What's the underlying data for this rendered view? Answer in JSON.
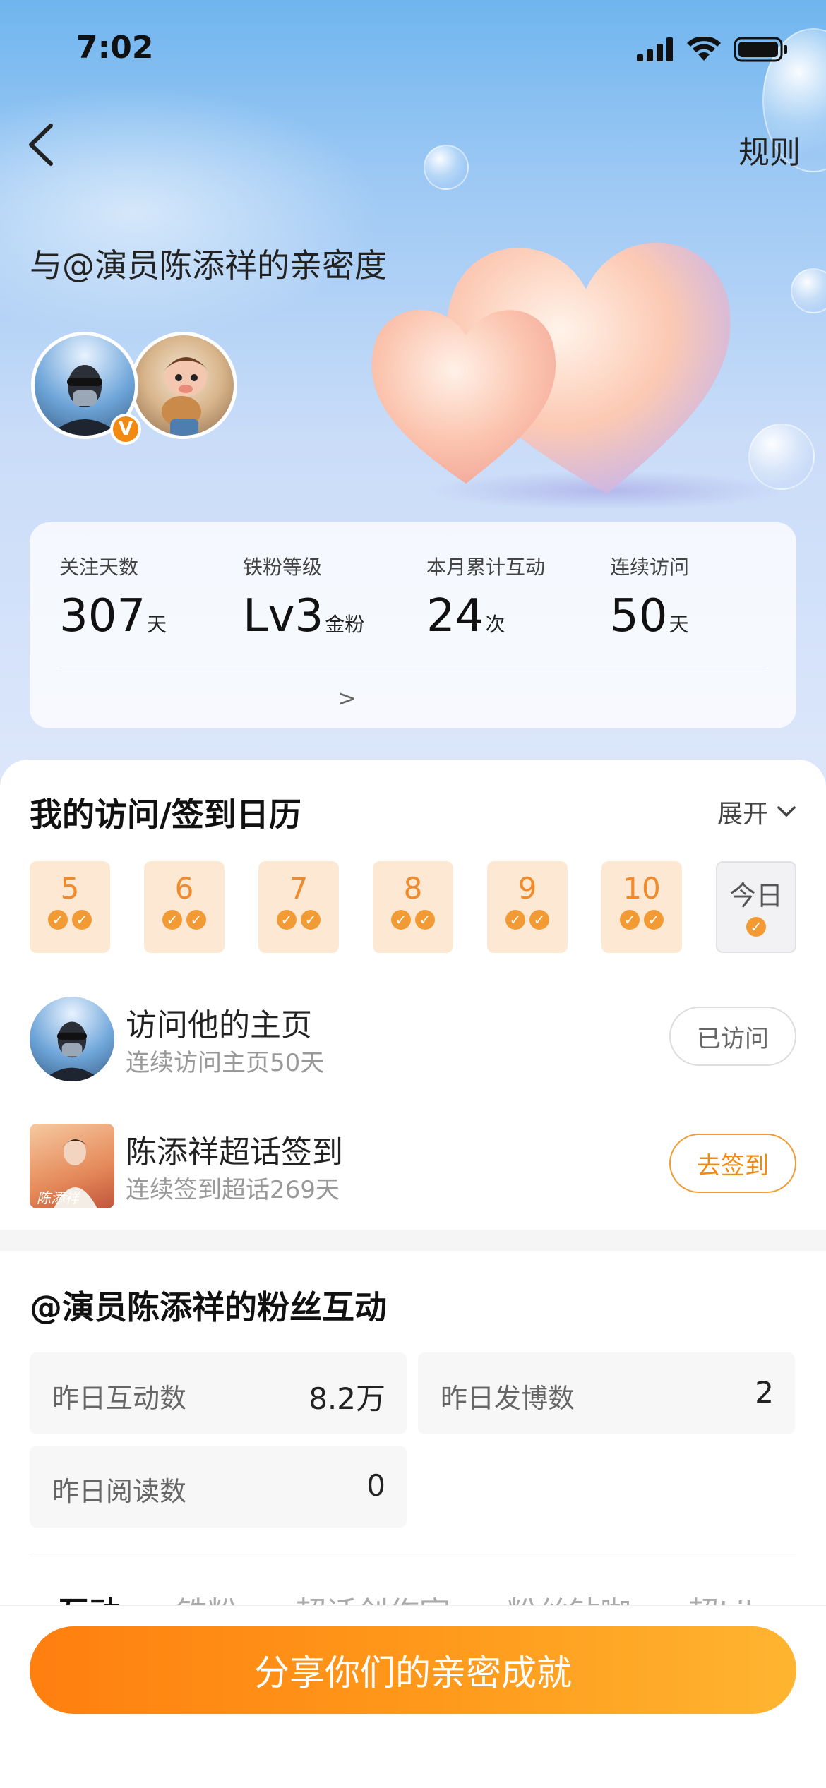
{
  "status_bar": {
    "time": "7:02"
  },
  "header": {
    "rules_label": "规则"
  },
  "hero": {
    "title": "与@演员陈添祥的亲密度",
    "verified_badge": "V"
  },
  "stats": [
    {
      "label": "关注天数",
      "value": "307",
      "unit": "天"
    },
    {
      "label": "铁粉等级",
      "value": "Lv3",
      "unit": "金粉"
    },
    {
      "label": "本月累计互动",
      "value": "24",
      "unit": "次"
    },
    {
      "label": "连续访问",
      "value": "50",
      "unit": "天"
    }
  ],
  "stats_more": ">",
  "calendar": {
    "title": "我的访问/签到日历",
    "expand_label": "展开",
    "days": [
      {
        "label": "5",
        "checks": 2
      },
      {
        "label": "6",
        "checks": 2
      },
      {
        "label": "7",
        "checks": 2
      },
      {
        "label": "8",
        "checks": 2
      },
      {
        "label": "9",
        "checks": 2
      },
      {
        "label": "10",
        "checks": 2
      },
      {
        "label": "今日",
        "checks": 1
      }
    ]
  },
  "tasks": [
    {
      "title": "访问他的主页",
      "subtitle": "连续访问主页50天",
      "button": "已访问"
    },
    {
      "title": "陈添祥超话签到",
      "subtitle": "连续签到超话269天",
      "button": "去签到",
      "thumb_text": "陈添祥"
    }
  ],
  "fan_interaction": {
    "title": "@演员陈添祥的粉丝互动",
    "metrics": [
      {
        "label": "昨日互动数",
        "value": "8.2万"
      },
      {
        "label": "昨日发博数",
        "value": "2"
      },
      {
        "label": "昨日阅读数",
        "value": "0"
      }
    ],
    "tabs": [
      "互动",
      "铁粉",
      "超话创作官",
      "粉丝钻咖",
      "超Like"
    ]
  },
  "share_button": "分享你们的亲密成就",
  "colors": {
    "accent": "#f08a12",
    "calendar_bg": "#fde9d3"
  }
}
